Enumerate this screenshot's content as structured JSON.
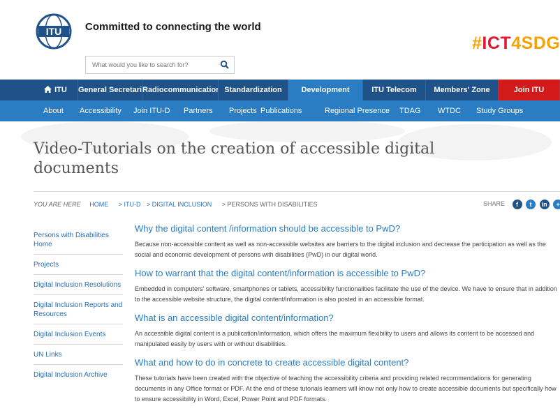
{
  "header": {
    "tagline": "Committed to connecting the world",
    "search_placeholder": "What would you like to search for?",
    "hashtag_prefix": "#",
    "hashtag_red": "ICT",
    "hashtag_rest": "4SDG"
  },
  "main_nav": {
    "home": "ITU",
    "items": [
      "General Secretariat",
      "Radiocommunication",
      "Standardization",
      "Development",
      "ITU Telecom",
      "Members' Zone",
      "Join ITU"
    ]
  },
  "sub_nav": {
    "items": [
      "About",
      "Accessibility",
      "Join ITU-D",
      "Partners",
      "Projects",
      "Publications",
      "Regional Presence",
      "TDAG",
      "WTDC",
      "Study Groups"
    ]
  },
  "page": {
    "title": "Video-Tutorials on the creation of accessible digital documents"
  },
  "breadcrumb": {
    "you_are_here": "YOU ARE HERE",
    "items": [
      "HOME",
      "> ITU-D",
      "> DIGITAL INCLUSION",
      "> PERSONS WITH DISABILITIES"
    ]
  },
  "share": {
    "label": "SHARE"
  },
  "sidebar": {
    "items": [
      "Persons with Disabilities Home",
      "Projects",
      "Digital Inclusion Resolutions",
      "Digital Inclusion Reports and Resources",
      "Digital Inclusion Events",
      "UN Links",
      "Digital Inclusion Archive"
    ]
  },
  "content": {
    "sections": [
      {
        "heading": "Why the digital content /information should be accessible to PwD?",
        "body": "Because non-accessible content as well as non-accessible websites are barriers to the digital inclusion and decrease the participation as well as the social and economic development of persons with disabilities (PwD) in our digital world."
      },
      {
        "heading": "How to warrant that the digital content/information is accessible to PwD?",
        "body": "Embedded in computers' software, smartphones or tablets, accessibility functionalities facilitate the use of the device. We have to ensure that in addition to the accessible website structure, the digital content/information is also posted in an accessible format."
      },
      {
        "heading": "What is an accessible digital content/information?",
        "body": "An accessible digital content is a publication/information, which offers the maximum flexibility to users and allows its content to be accessed and manipulated easily by users with or without disabilities."
      },
      {
        "heading": "What and how to do in concrete to create accessible digital content?",
        "body": "These tutorials have been created with the objective of teaching the accessibility criteria and providing related recommendations for generating documents in any Office format or PDF. At the end of these tutorials learners will know not only how to create accessible documents but specifically how to ensure accessibility in Word, Excel, Power Point and PDF formats."
      }
    ]
  },
  "colors": {
    "main_nav": "#1f5289",
    "sub_nav": "#2a7dc2",
    "active_tab": "#2a7dc2",
    "join_itu": "#d31a1a",
    "link": "#2a6fb5",
    "hashtag_orange": "#f5a300",
    "hashtag_red": "#e21836"
  },
  "icons": [
    "itu-logo",
    "search-icon",
    "home-icon",
    "facebook-icon",
    "twitter-icon",
    "linkedin-icon",
    "share-more-icon"
  ]
}
